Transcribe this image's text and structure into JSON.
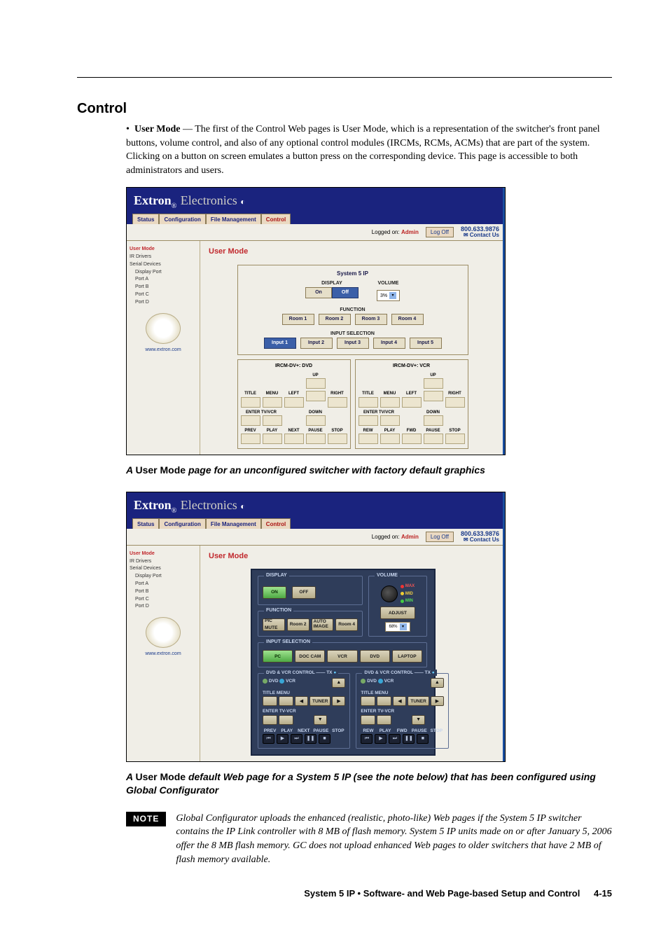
{
  "section_title": "Control",
  "bullet": {
    "term": "User Mode",
    "text": " — The first of the Control Web pages is User Mode, which is a representation of the switcher's front panel buttons, volume control, and also of any optional control modules (IRCMs, RCMs, ACMs) that are part of the system. Clicking on a button on screen emulates a button press on the corresponding device.  This page is accessible to both administrators and users."
  },
  "caption1_a": "A ",
  "caption1_b": "User Mode",
  "caption1_c": " page for an unconfigured switcher with factory default graphics",
  "caption2_a": "A ",
  "caption2_b": "User Mode",
  "caption2_c": " default Web page for a System 5 IP (see the note below) that has been configured using Global Configurator",
  "note_badge": "NOTE",
  "note_text": "Global Configurator uploads the enhanced (realistic, photo-like) Web pages if the System 5 IP switcher contains the IP Link controller with 8 MB of flash memory.  System 5 IP units made on or after January 5, 2006 offer the 8 MB flash memory.  GC does not upload enhanced Web pages to older switchers that have 2 MB of flash memory available.",
  "footer_title": "System 5 IP • Software- and Web Page-based Setup and Control",
  "footer_page": "4-15",
  "brand_a": "Extron",
  "brand_b": " Electronics",
  "tabs": [
    "Status",
    "Configuration",
    "File Management",
    "Control"
  ],
  "subbar": {
    "logged_prefix": "Logged on: ",
    "logged_user": "Admin",
    "logoff": "Log Off",
    "phone": "800.633.9876",
    "contact": "Contact Us"
  },
  "sidebar": {
    "items": [
      "User Mode",
      "IR Drivers",
      "Serial Devices",
      "Display Port",
      "Port A",
      "Port B",
      "Port C",
      "Port D"
    ],
    "www": "www.extron.com"
  },
  "panel_title": "User Mode",
  "shot1": {
    "header": "System 5 IP",
    "display_lbl": "DISPLAY",
    "on": "On",
    "off": "Off",
    "volume_lbl": "VOLUME",
    "volume_val": "3%",
    "function_lbl": "FUNCTION",
    "rooms": [
      "Room 1",
      "Room 2",
      "Room 3",
      "Room 4"
    ],
    "inputsel_lbl": "INPUT SELECTION",
    "inputs": [
      "Input 1",
      "Input 2",
      "Input 3",
      "Input 4",
      "Input 5"
    ],
    "rem": [
      {
        "title": "IRCM-DV+: DVD",
        "row1": [
          "TITLE",
          "MENU",
          "LEFT",
          "",
          "RIGHT"
        ],
        "up": "UP",
        "row2a": "ENTER TV/VCR",
        "down": "DOWN",
        "row3": [
          "PREV",
          "PLAY",
          "NEXT",
          "PAUSE",
          "STOP"
        ]
      },
      {
        "title": "IRCM-DV+: VCR",
        "row1": [
          "TITLE",
          "MENU",
          "LEFT",
          "",
          "RIGHT"
        ],
        "up": "UP",
        "row2a": "ENTER TV/VCR",
        "down": "DOWN",
        "row3": [
          "REW",
          "PLAY",
          "FWD",
          "PAUSE",
          "STOP"
        ]
      }
    ]
  },
  "shot2": {
    "display": {
      "legend": "DISPLAY",
      "on": "ON",
      "off": "OFF"
    },
    "volume": {
      "legend": "VOLUME",
      "adjust": "ADJUST",
      "val": "68%",
      "max": "MAX",
      "mid": "MID",
      "min": "MIN"
    },
    "function": {
      "legend": "FUNCTION",
      "b": [
        "PIC MUTE",
        "Room 2",
        "AUTO IMAGE",
        "Room 4"
      ]
    },
    "inputsel": {
      "legend": "INPUT SELECTION",
      "b": [
        "PC",
        "DOC CAM",
        "VCR",
        "DVD",
        "LAPTOP"
      ]
    },
    "rem_legend": "DVD & VCR CONTROL",
    "tx": "TX",
    "dvd": "DVD",
    "vcr": "VCR",
    "title_menu": "TITLE MENU",
    "tuner": "TUNER",
    "enter": "ENTER TV-VCR",
    "tr1": [
      "PREV",
      "PLAY",
      "NEXT",
      "PAUSE",
      "STOP"
    ],
    "tr2": [
      "REW",
      "PLAY",
      "FWD",
      "PAUSE",
      "STOP"
    ]
  }
}
